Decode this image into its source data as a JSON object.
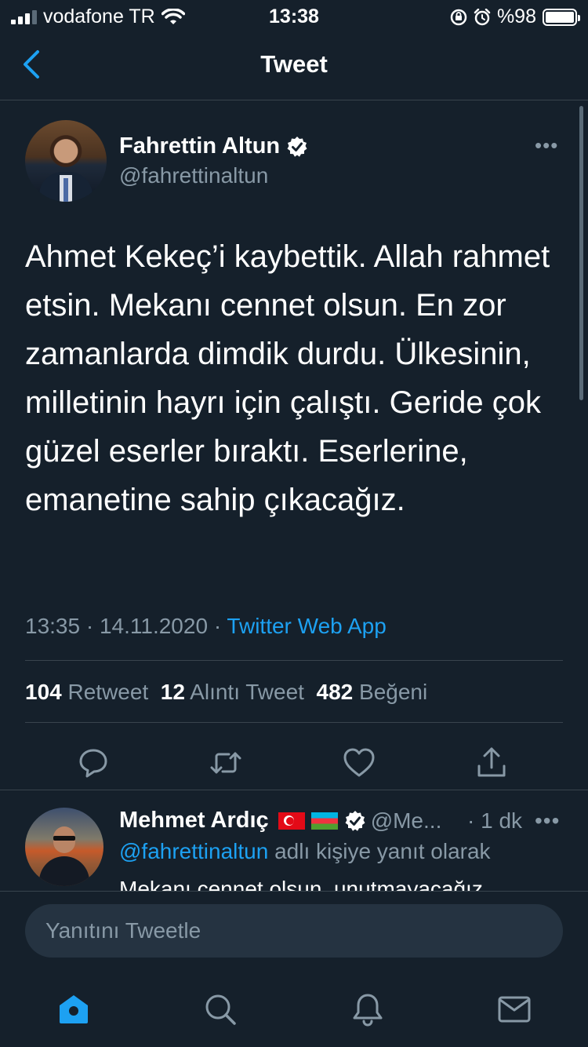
{
  "status_bar": {
    "carrier": "vodafone TR",
    "time": "13:38",
    "battery": "%98"
  },
  "header": {
    "title": "Tweet"
  },
  "tweet": {
    "author_name": "Fahrettin Altun",
    "author_handle": "@fahrettinaltun",
    "text": "Ahmet Kekeç’i kaybettik. Allah rahmet etsin. Mekanı cennet olsun. En zor zamanlarda dimdik durdu. Ülkesinin, milletinin hayrı için çalıştı. Geride çok güzel eserler bıraktı. Eserlerine, emanetine sahip çıkacağız.",
    "time": "13:35",
    "date": "14.11.2020",
    "separator": "·",
    "source": "Twitter Web App",
    "stats": {
      "retweets": "104",
      "retweets_label": "Retweet",
      "quotes": "12",
      "quotes_label": "Alıntı Tweet",
      "likes": "482",
      "likes_label": "Beğeni"
    },
    "more_label": "•••"
  },
  "reply": {
    "author_name": "Mehmet Ardıç",
    "author_handle": "@Me...",
    "time": "· 1 dk",
    "more_label": "•••",
    "context_mention": "@fahrettinaltun",
    "context_suffix": " adlı kişiye yanıt olarak",
    "text": "Mekanı cennet olsun, unutmayacağız."
  },
  "compose": {
    "placeholder": "Yanıtını Tweetle"
  },
  "colors": {
    "background": "#15202b",
    "accent": "#1da1f2",
    "secondary_text": "#8899a6",
    "divider": "#38444d"
  },
  "icons": {
    "actions": [
      "reply-icon",
      "retweet-icon",
      "like-icon",
      "share-icon"
    ],
    "tabs": [
      "home-icon",
      "search-icon",
      "notifications-icon",
      "messages-icon"
    ]
  }
}
